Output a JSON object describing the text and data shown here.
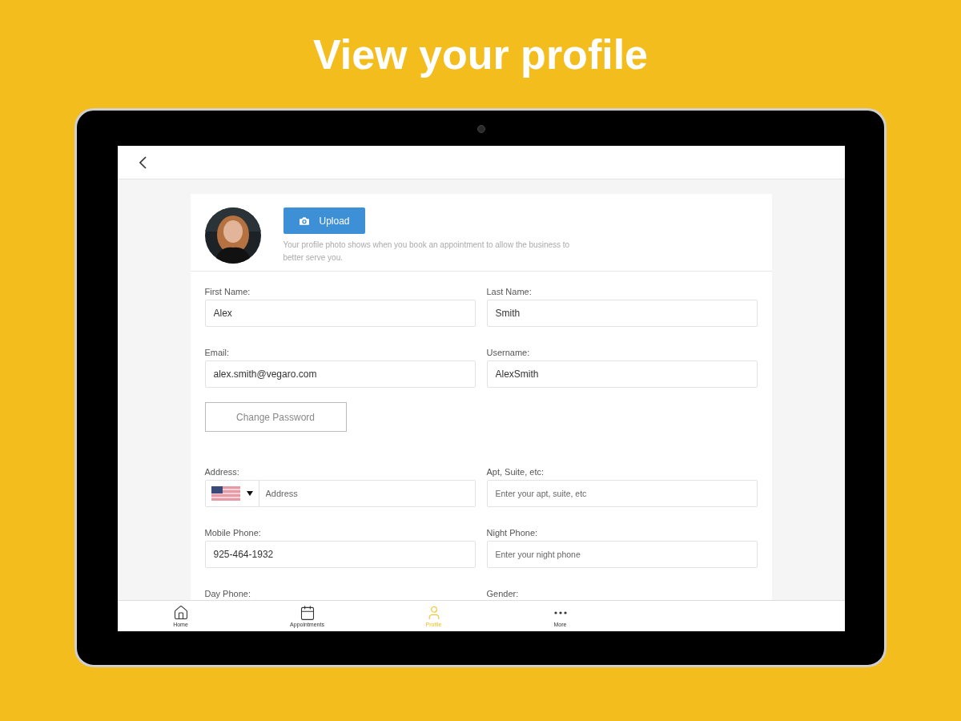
{
  "headline": "View your profile",
  "profile": {
    "upload_button": "Upload",
    "photo_hint": "Your profile photo shows when you book an appointment to allow the business to better serve you."
  },
  "fields_top": [
    {
      "kind": "text",
      "label": "First Name:",
      "value": "Alex"
    },
    {
      "kind": "text",
      "label": "Last Name:",
      "value": "Smith"
    },
    {
      "kind": "text",
      "label": "Email:",
      "value": "alex.smith@vegaro.com"
    },
    {
      "kind": "text",
      "label": "Username:",
      "value": "AlexSmith"
    }
  ],
  "change_password_button": "Change Password",
  "fields_bottom": [
    {
      "kind": "address",
      "label": "Address:",
      "placeholder": "Address"
    },
    {
      "kind": "text",
      "label": "Apt, Suite, etc:",
      "placeholder": "Enter your apt, suite, etc"
    },
    {
      "kind": "text",
      "label": "Mobile Phone:",
      "value": "925-464-1932"
    },
    {
      "kind": "text",
      "label": "Night Phone:",
      "placeholder": "Enter your night phone"
    },
    {
      "kind": "label_only",
      "label": "Day Phone:"
    },
    {
      "kind": "label_only",
      "label": "Gender:"
    }
  ],
  "nav": [
    {
      "label": "Home",
      "selected": false
    },
    {
      "label": "Appointments",
      "selected": false
    },
    {
      "label": "Profile",
      "selected": true
    },
    {
      "label": "More",
      "selected": false
    }
  ]
}
